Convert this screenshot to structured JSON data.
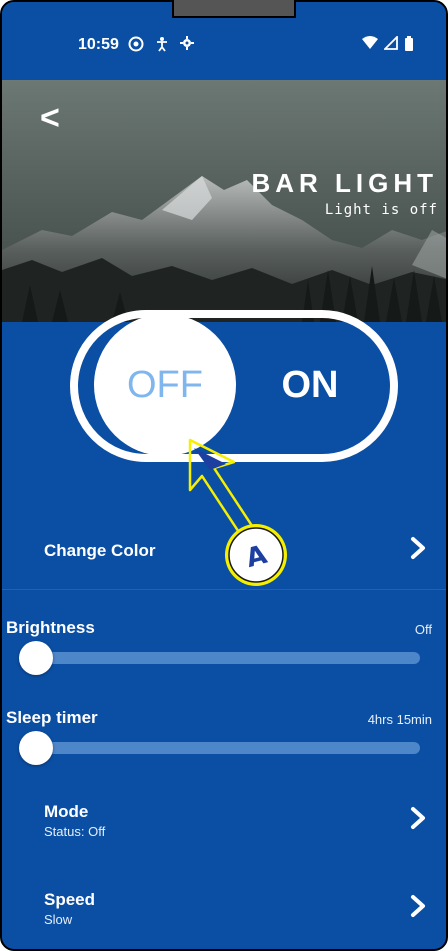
{
  "status_bar": {
    "time": "10:59",
    "icons_left": [
      "browser-icon",
      "accessibility-icon",
      "gear-icon"
    ],
    "icons_right": [
      "wifi-icon",
      "signal-icon",
      "battery-icon"
    ]
  },
  "header": {
    "back_glyph": "<",
    "title": "BAR LIGHT",
    "subtitle": "Light is off"
  },
  "power_toggle": {
    "off_label": "OFF",
    "on_label": "ON",
    "state": "off"
  },
  "annotation": {
    "marker_label": "A",
    "color": "#f5f000"
  },
  "change_color": {
    "label": "Change Color"
  },
  "brightness": {
    "label": "Brightness",
    "value_text": "Off",
    "fraction": 0.0
  },
  "sleep_timer": {
    "label": "Sleep timer",
    "value_text": "4hrs 15min",
    "fraction": 0.0
  },
  "mode": {
    "label": "Mode",
    "status": "Status: Off"
  },
  "speed": {
    "label": "Speed",
    "status": "Slow"
  },
  "colors": {
    "background": "#0b4fa4",
    "track": "#4d86c9",
    "toggle_off_text": "#7fb6ee"
  }
}
